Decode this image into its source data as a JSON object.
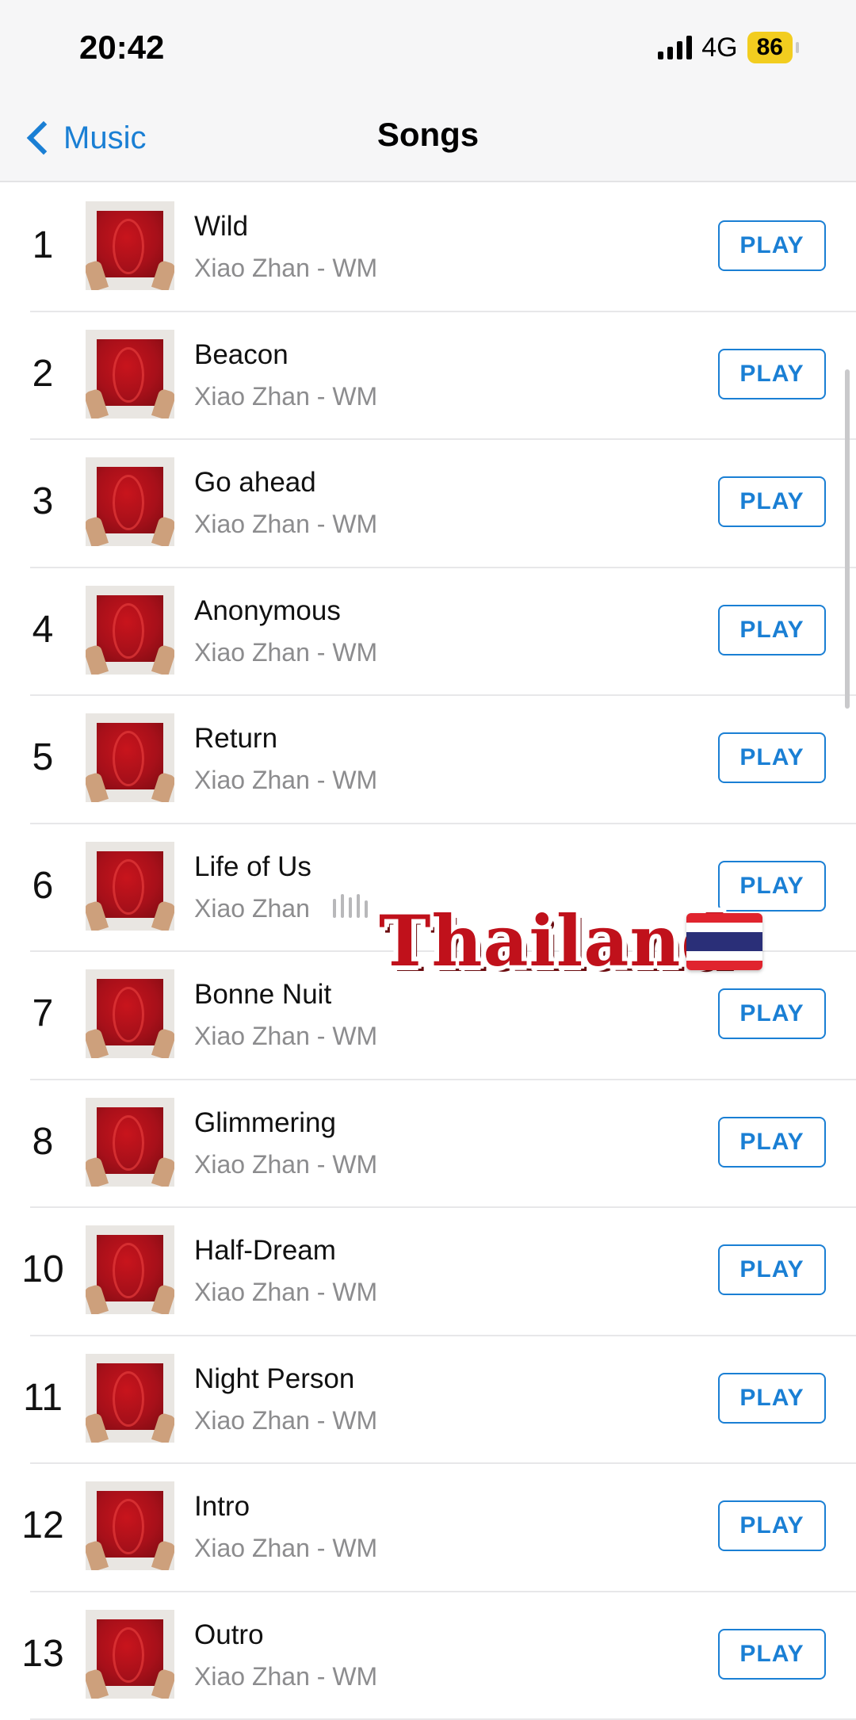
{
  "status_bar": {
    "time": "20:42",
    "network": "4G",
    "battery": "86"
  },
  "nav": {
    "back_label": "Music",
    "title": "Songs"
  },
  "songs": [
    {
      "rank": "1",
      "title": "Wild",
      "subtitle": "Xiao Zhan - WM",
      "button": "PLAY"
    },
    {
      "rank": "2",
      "title": "Beacon",
      "subtitle": "Xiao Zhan - WM",
      "button": "PLAY"
    },
    {
      "rank": "3",
      "title": "Go ahead",
      "subtitle": "Xiao Zhan - WM",
      "button": "PLAY"
    },
    {
      "rank": "4",
      "title": "Anonymous",
      "subtitle": "Xiao Zhan - WM",
      "button": "PLAY"
    },
    {
      "rank": "5",
      "title": "Return",
      "subtitle": "Xiao Zhan - WM",
      "button": "PLAY"
    },
    {
      "rank": "6",
      "title": "Life of Us",
      "subtitle": "Xiao Zhan",
      "button": "PLAY"
    },
    {
      "rank": "7",
      "title": "Bonne Nuit",
      "subtitle": "Xiao Zhan - WM",
      "button": "PLAY"
    },
    {
      "rank": "8",
      "title": "Glimmering",
      "subtitle": "Xiao Zhan - WM",
      "button": "PLAY"
    },
    {
      "rank": "10",
      "title": "Half-Dream",
      "subtitle": "Xiao Zhan - WM",
      "button": "PLAY"
    },
    {
      "rank": "11",
      "title": "Night Person",
      "subtitle": "Xiao Zhan - WM",
      "button": "PLAY"
    },
    {
      "rank": "12",
      "title": "Intro",
      "subtitle": "Xiao Zhan - WM",
      "button": "PLAY"
    },
    {
      "rank": "13",
      "title": "Outro",
      "subtitle": "Xiao Zhan - WM",
      "button": "PLAY"
    }
  ],
  "overlay": {
    "text": "Thailand",
    "flag_icon": "thailand-flag-icon"
  },
  "colors": {
    "accent": "#1a7fd4",
    "overlay_text": "#c0111b"
  }
}
